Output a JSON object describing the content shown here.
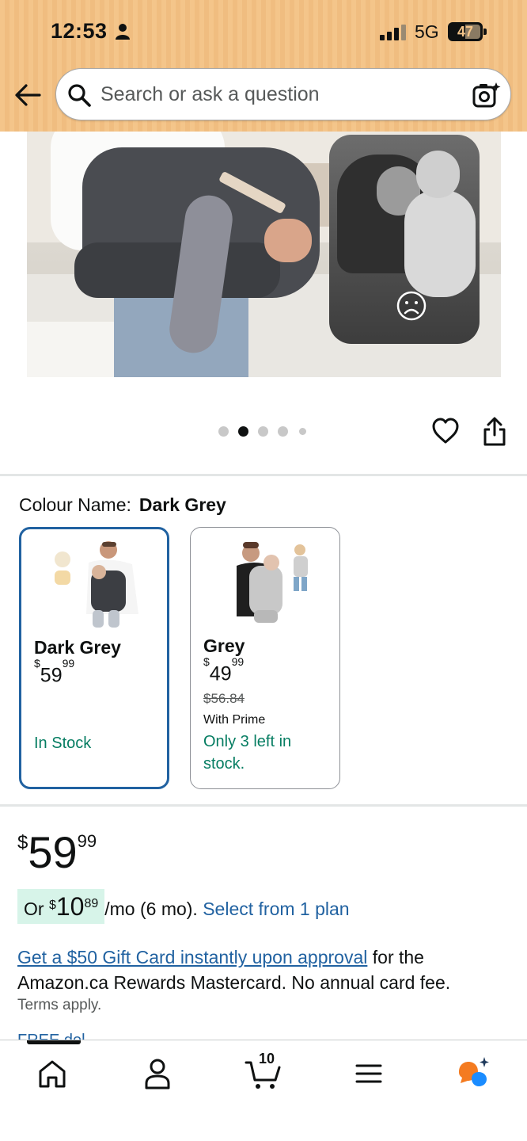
{
  "status_bar": {
    "time": "12:53",
    "network": "5G",
    "battery": "47"
  },
  "header": {
    "search_placeholder": "Search or ask a question"
  },
  "gallery": {
    "dot_count": 5,
    "active_index": 1
  },
  "colour": {
    "label": "Colour Name:",
    "selected": "Dark Grey",
    "options": [
      {
        "name": "Dark Grey",
        "price_dollars": "59",
        "price_cents": "99",
        "stock": "In Stock"
      },
      {
        "name": "Grey",
        "price_dollars": "49",
        "price_cents": "99",
        "list_price": "$56.84",
        "prime_note": "With Prime",
        "stock": "Only 3 left in stock."
      }
    ]
  },
  "price": {
    "currency": "$",
    "dollars": "59",
    "cents": "99"
  },
  "plan": {
    "prefix": "Or",
    "currency": "$",
    "dollars": "10",
    "cents": "89",
    "suffix": "/mo (6 mo).",
    "link": "Select from 1 plan"
  },
  "promo": {
    "link": "Get a $50 Gift Card instantly upon approval",
    "text": " for the Amazon.ca Rewards Mastercard. No annual card fee.",
    "terms": "Terms apply.",
    "next_line_peek": "FREE del"
  },
  "bottom_nav": {
    "cart_count": "10",
    "items": [
      "home-icon",
      "account-icon",
      "cart-icon",
      "menu-icon",
      "rufus-assistant-icon"
    ]
  },
  "colors": {
    "header_bg": "#f4c58a",
    "link": "#2162a1",
    "in_stock": "#067d62",
    "selected_border": "#2162a1",
    "plan_pill_bg": "#d7f4e9"
  }
}
